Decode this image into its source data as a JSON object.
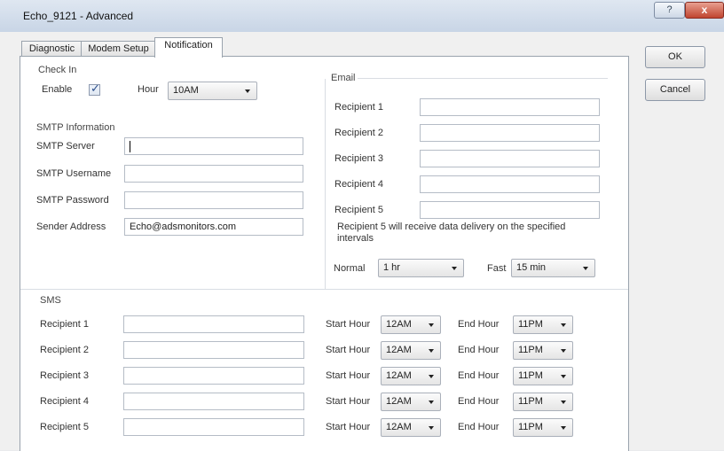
{
  "window": {
    "title": "Echo_9121 - Advanced",
    "help_glyph": "?",
    "close_glyph": "x"
  },
  "tabs": [
    {
      "label": "Diagnostic",
      "active": false
    },
    {
      "label": "Modem Setup",
      "active": false
    },
    {
      "label": "Notification",
      "active": true
    }
  ],
  "check_in": {
    "title": "Check In",
    "enable_label": "Enable",
    "enabled": true,
    "check_glyph": "✓",
    "hour_label": "Hour",
    "hour_value": "10AM"
  },
  "smtp": {
    "title": "SMTP Information",
    "server_label": "SMTP Server",
    "server_value": "",
    "username_label": "SMTP Username",
    "username_value": "",
    "password_label": "SMTP Password",
    "password_value": "",
    "sender_label": "Sender Address",
    "sender_value": "Echo@adsmonitors.com"
  },
  "email": {
    "title": "Email",
    "recipients": [
      {
        "label": "Recipient 1",
        "value": ""
      },
      {
        "label": "Recipient 2",
        "value": ""
      },
      {
        "label": "Recipient 3",
        "value": ""
      },
      {
        "label": "Recipient 4",
        "value": ""
      },
      {
        "label": "Recipient 5",
        "value": ""
      }
    ],
    "note": "Recipient 5 will receive data delivery on the specified intervals",
    "normal_label": "Normal",
    "normal_value": "1 hr",
    "fast_label": "Fast",
    "fast_value": "15 min"
  },
  "sms": {
    "title": "SMS",
    "start_label": "Start Hour",
    "end_label": "End Hour",
    "rows": [
      {
        "label": "Recipient 1",
        "value": "",
        "start": "12AM",
        "end": "11PM"
      },
      {
        "label": "Recipient 2",
        "value": "",
        "start": "12AM",
        "end": "11PM"
      },
      {
        "label": "Recipient 3",
        "value": "",
        "start": "12AM",
        "end": "11PM"
      },
      {
        "label": "Recipient 4",
        "value": "",
        "start": "12AM",
        "end": "11PM"
      },
      {
        "label": "Recipient 5",
        "value": "",
        "start": "12AM",
        "end": "11PM"
      }
    ]
  },
  "buttons": {
    "ok": "OK",
    "cancel": "Cancel"
  }
}
